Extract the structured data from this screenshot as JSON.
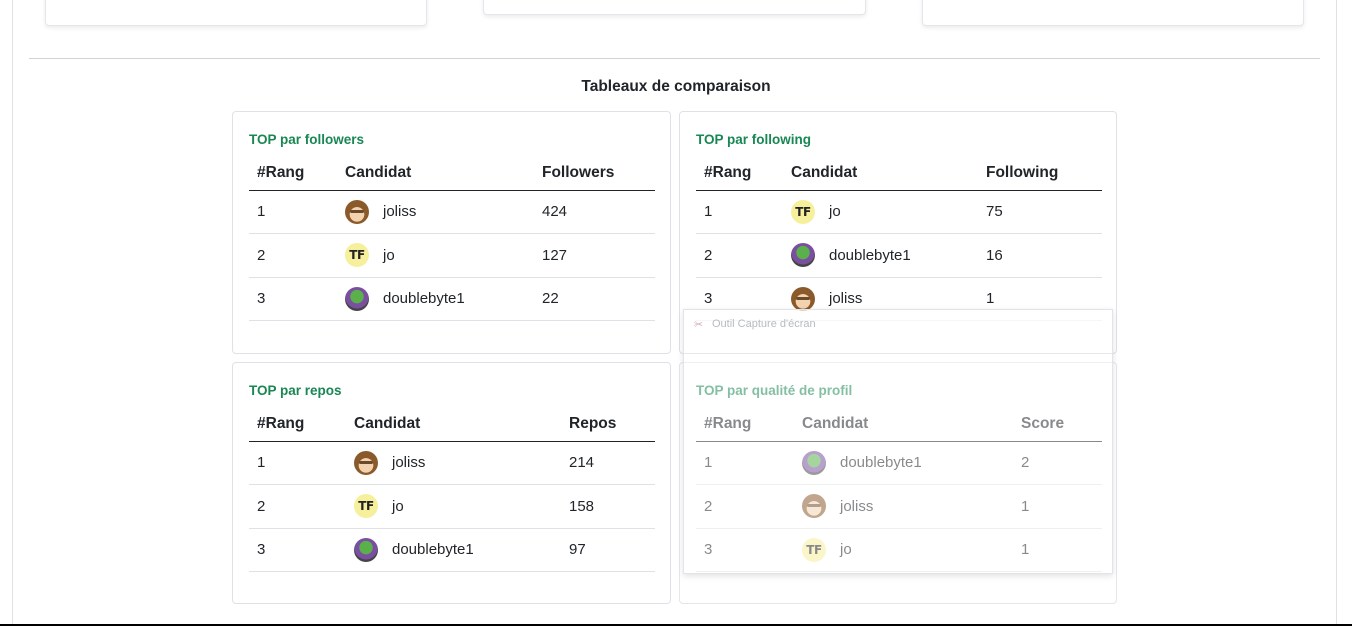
{
  "section_title": "Tableaux de comparaison",
  "columns": {
    "rank": "#Rang",
    "candidate": "Candidat"
  },
  "tables": [
    {
      "title": "TOP par followers",
      "metric": "Followers",
      "rows": [
        {
          "rank": "1",
          "name": "joliss",
          "value": "424",
          "avatar": "joliss"
        },
        {
          "rank": "2",
          "name": "jo",
          "value": "127",
          "avatar": "jo"
        },
        {
          "rank": "3",
          "name": "doublebyte1",
          "value": "22",
          "avatar": "doublebyte1"
        }
      ]
    },
    {
      "title": "TOP par following",
      "metric": "Following",
      "rows": [
        {
          "rank": "1",
          "name": "jo",
          "value": "75",
          "avatar": "jo"
        },
        {
          "rank": "2",
          "name": "doublebyte1",
          "value": "16",
          "avatar": "doublebyte1"
        },
        {
          "rank": "3",
          "name": "joliss",
          "value": "1",
          "avatar": "joliss"
        }
      ]
    },
    {
      "title": "TOP par repos",
      "metric": "Repos",
      "rows": [
        {
          "rank": "1",
          "name": "joliss",
          "value": "214",
          "avatar": "joliss"
        },
        {
          "rank": "2",
          "name": "jo",
          "value": "158",
          "avatar": "jo"
        },
        {
          "rank": "3",
          "name": "doublebyte1",
          "value": "97",
          "avatar": "doublebyte1"
        }
      ]
    },
    {
      "title": "TOP par qualité de profil",
      "metric": "Score",
      "rows": [
        {
          "rank": "1",
          "name": "doublebyte1",
          "value": "2",
          "avatar": "doublebyte1"
        },
        {
          "rank": "2",
          "name": "joliss",
          "value": "1",
          "avatar": "joliss"
        },
        {
          "rank": "3",
          "name": "jo",
          "value": "1",
          "avatar": "jo"
        }
      ]
    }
  ],
  "avatar_text": {
    "jo": "TF"
  },
  "overlay": {
    "label": "Outil Capture d'écran"
  },
  "colors": {
    "accent": "#198754",
    "border": "#dee2e6"
  }
}
